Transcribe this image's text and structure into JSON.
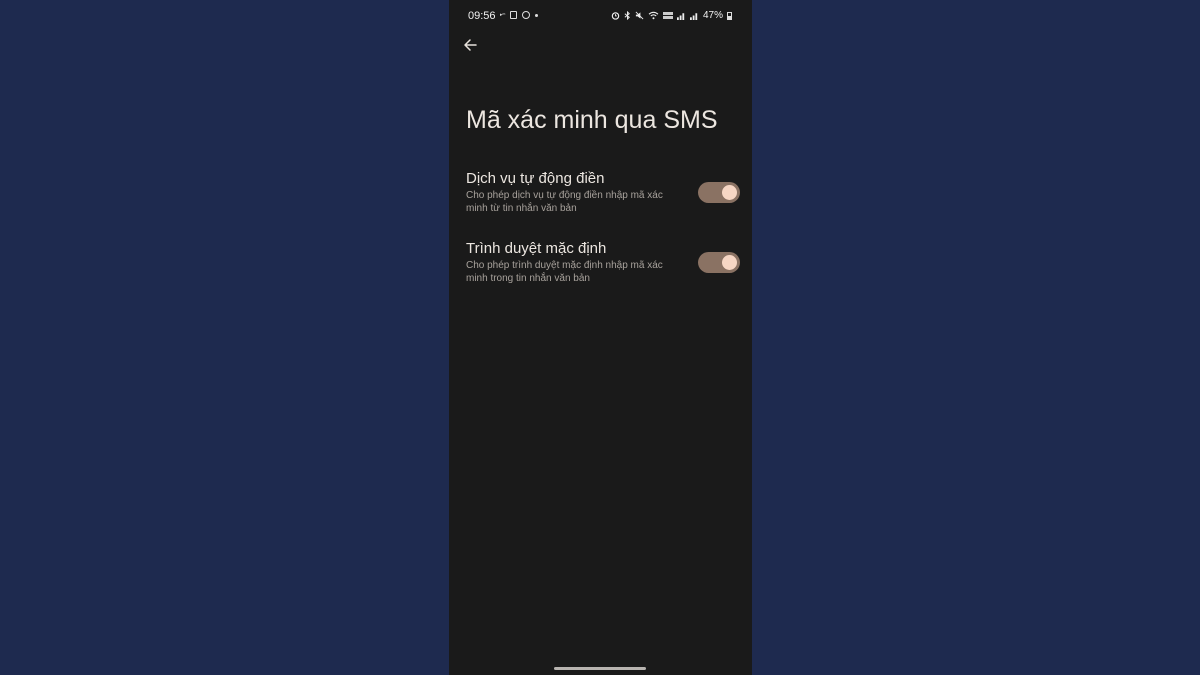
{
  "status_bar": {
    "time": "09:56",
    "left_icons": [
      "video-icon",
      "app-notification-icon",
      "messenger-icon",
      "more-dot-icon"
    ],
    "right_icons": [
      "alarm-icon",
      "bluetooth-icon",
      "mute-icon",
      "wifi-icon",
      "volte-icon",
      "signal-icon",
      "signal-icon"
    ],
    "battery": "47%"
  },
  "header": {
    "back_icon": "arrow-left-icon",
    "title": "Mã xác minh qua SMS"
  },
  "settings": [
    {
      "title": "Dịch vụ tự động điền",
      "description": "Cho phép dịch vụ tự động điền nhập mã xác minh từ tin nhắn văn bản",
      "enabled": true
    },
    {
      "title": "Trình duyệt mặc định",
      "description": "Cho phép trình duyệt mặc định nhập mã xác minh trong tin nhắn văn bản",
      "enabled": true
    }
  ],
  "colors": {
    "background": "#1e2a4f",
    "phone_background": "#1a1a1a",
    "toggle_track": "#8a7263",
    "toggle_knob": "#f6d6c4"
  }
}
